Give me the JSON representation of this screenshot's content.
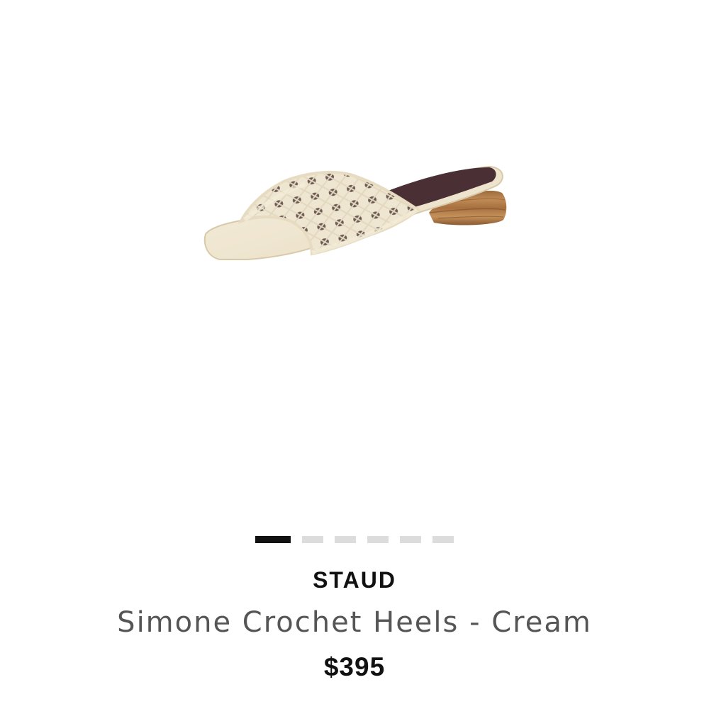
{
  "product": {
    "brand": "STAUD",
    "name": "Simone Crochet Heels - Cream",
    "price": "$395",
    "image": "cream crochet slide sandal with wooden block heel"
  },
  "carousel": {
    "total_slides": 6,
    "active_index": 0
  },
  "colors": {
    "text_primary": "#111111",
    "text_secondary": "#555555",
    "dot_active": "#111111",
    "dot_inactive": "#dcdcdc",
    "sandal_cream": "#f1e9d6",
    "heel_wood": "#b07a45",
    "insole_lining": "#4a2f35"
  }
}
